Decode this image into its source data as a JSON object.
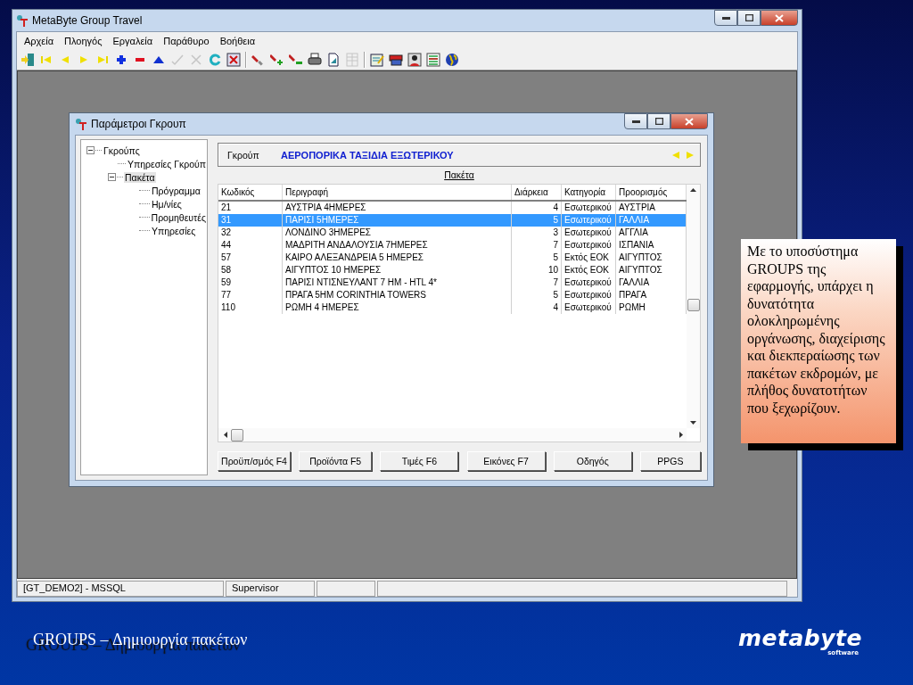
{
  "window": {
    "title": "MetaByte Group Travel"
  },
  "menu": [
    "Αρχεία",
    "Πλοηγός",
    "Εργαλεία",
    "Παράθυρο",
    "Βοήθεια"
  ],
  "toolbar": [
    {
      "kind": "exit",
      "disabled": false
    },
    {
      "kind": "first",
      "disabled": false
    },
    {
      "kind": "prev",
      "disabled": false
    },
    {
      "kind": "next",
      "disabled": false
    },
    {
      "kind": "last",
      "disabled": false
    },
    {
      "kind": "plus",
      "disabled": false
    },
    {
      "kind": "minus",
      "disabled": false
    },
    {
      "kind": "up",
      "disabled": false
    },
    {
      "kind": "check",
      "disabled": true
    },
    {
      "kind": "cross",
      "disabled": true
    },
    {
      "kind": "refresh",
      "disabled": false
    },
    {
      "kind": "closebox",
      "disabled": false
    },
    {
      "kind": "separator"
    },
    {
      "kind": "flashlight",
      "disabled": false
    },
    {
      "kind": "flashlight-plus",
      "disabled": false
    },
    {
      "kind": "flashlight-minus",
      "disabled": false
    },
    {
      "kind": "printer",
      "disabled": false
    },
    {
      "kind": "document",
      "disabled": false
    },
    {
      "kind": "grid",
      "disabled": true
    },
    {
      "kind": "separator"
    },
    {
      "kind": "notepad",
      "disabled": false
    },
    {
      "kind": "folders",
      "disabled": false
    },
    {
      "kind": "person",
      "disabled": false
    },
    {
      "kind": "list",
      "disabled": false
    },
    {
      "kind": "globe",
      "disabled": false
    }
  ],
  "dialog": {
    "title": "Παράμετροι Γκρουπ",
    "tree": [
      {
        "label": "Γκρούπς",
        "expanded": true,
        "selected": false,
        "children": [
          {
            "label": "Υπηρεσίες Γκρούπ",
            "selected": false
          },
          {
            "label": "Πακέτα",
            "expanded": true,
            "selected": true,
            "children": [
              {
                "label": "Πρόγραμμα",
                "selected": false
              },
              {
                "label": "Ημ/νίες",
                "selected": false
              },
              {
                "label": "Προμηθευτές",
                "selected": false
              },
              {
                "label": "Υπηρεσίες",
                "selected": false
              }
            ]
          }
        ]
      }
    ],
    "group": {
      "label": "Γκρούπ",
      "value": "ΑΕΡΟΠΟΡΙΚΑ ΤΑΞΙΔΙΑ ΕΞΩΤΕΡΙΚΟΥ"
    },
    "section_title": "Πακέτα",
    "table": {
      "columns": [
        "Κωδικός",
        "Περιγραφή",
        "Διάρκεια",
        "Κατηγορία",
        "Προορισμός"
      ],
      "rows": [
        {
          "cells": [
            "21",
            "ΑΥΣΤΡΙΑ 4ΗΜΕΡΕΣ",
            "4",
            "Εσωτερικού",
            "ΑΥΣΤΡΙΑ"
          ],
          "selected": false
        },
        {
          "cells": [
            "31",
            "ΠΑΡΙΣΙ 5ΗΜΕΡΕΣ",
            "5",
            "Εσωτερικού",
            "ΓΑΛΛΙΑ"
          ],
          "selected": true
        },
        {
          "cells": [
            "32",
            "ΛΟΝΔΙΝΟ  3ΗΜΕΡΕΣ",
            "3",
            "Εσωτερικού",
            "ΑΓΓΛΙΑ"
          ],
          "selected": false
        },
        {
          "cells": [
            "44",
            "ΜΑΔΡΙΤΗ ΑΝΔΑΛΟΥΣΙΑ 7ΗΜΕΡΕΣ",
            "7",
            "Εσωτερικού",
            "ΙΣΠΑΝΙΑ"
          ],
          "selected": false
        },
        {
          "cells": [
            "57",
            "ΚΑΙΡΟ ΑΛΕΞΑΝΔΡΕΙΑ 5 ΗΜΕΡΕΣ",
            "5",
            "Εκτός ΕΟΚ",
            "ΑΙΓΥΠΤΟΣ"
          ],
          "selected": false
        },
        {
          "cells": [
            "58",
            "ΑΙΓΥΠΤΟΣ 10 ΗΜΕΡΕΣ",
            "10",
            "Εκτός ΕΟΚ",
            "ΑΙΓΥΠΤΟΣ"
          ],
          "selected": false
        },
        {
          "cells": [
            "59",
            "ΠΑΡΙΣΙ ΝΤΙΣΝΕΥΛΑΝΤ 7 ΗΜ - HTL 4*",
            "7",
            "Εσωτερικού",
            "ΓΑΛΛΙΑ"
          ],
          "selected": false
        },
        {
          "cells": [
            "77",
            "ΠΡΑΓΑ 5ΗΜ  CORINTHIA TOWERS",
            "5",
            "Εσωτερικού",
            "ΠΡΑΓΑ"
          ],
          "selected": false
        },
        {
          "cells": [
            "110",
            "ΡΩΜΗ 4 ΗΜΕΡΕΣ",
            "4",
            "Εσωτερικού",
            "ΡΩΜΗ"
          ],
          "selected": false
        }
      ]
    },
    "buttons": [
      "Προϋπ/σμός F4",
      "Προϊόντα  F5",
      "Τιμές F6",
      "Εικόνες F7",
      "Οδηγός",
      "PPGS"
    ]
  },
  "status_bar": [
    "[GT_DEMO2] - MSSQL",
    "Supervisor"
  ],
  "callout": "Με το υποσύστημα GROUPS της εφαρμογής, υπάρχει η δυνατότητα ολοκληρωμένης οργάνωσης, διαχείρισης και διεκπεραίωσης των πακέτων εκδρομών, με πλήθος δυνατοτήτων που ξεχωρίζουν.",
  "slide_title": "GROUPS – Δημιουργία πακέτων",
  "logo": {
    "name": "metabyte",
    "tagline": "software"
  }
}
